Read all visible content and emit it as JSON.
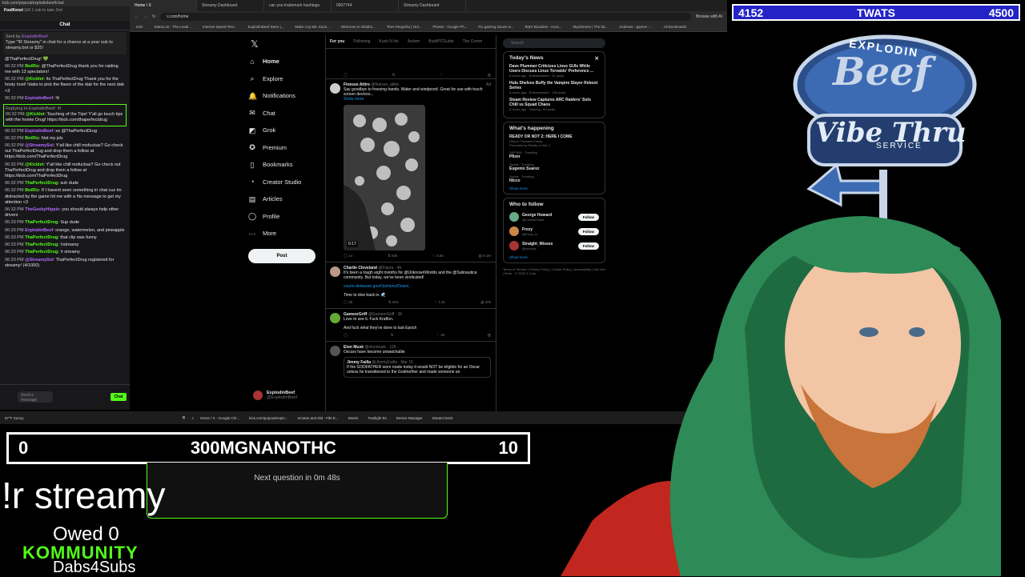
{
  "chat": {
    "url_bar": "kick.com/popout/explodinbeef/chat",
    "header": "Chat",
    "top_gifter": "FoolKenzi",
    "gift_text": "Gift 1 sub to take 2nd",
    "pin_sender": "Sent by",
    "pin_user": "ExplodinBeef",
    "pin_text": "Type \"!R Streamy\" in chat for a chance at a year sub to streamy.bot or $25!",
    "first_line": "@ThaPerfectDrug! 💚",
    "messages": [
      {
        "time": "06:32 PM",
        "user": "BotRix",
        "color": "#53fc18",
        "text": "@ThaPerfectDrug thank you for raiding me with 13 spectators!"
      },
      {
        "time": "06:32 PM",
        "user": "@Kicklet",
        "color": "#53fc18",
        "text": "Its ThaPerfectDrug Thank you for the hosty host! !dabs to pick the flavor of the dab for the next dab <3"
      },
      {
        "time": "06:32 PM",
        "user": "ExplodinBeef",
        "color": "#b36bff",
        "text": "!tt"
      },
      {
        "time": "06:32 PM",
        "user": "@Kicklet",
        "color": "#53fc18",
        "text": "Touching of the Tips! Y'all go touch tips with the homie Drug! https://kick.com/thaperfectdrug",
        "reply": "Replying to ExplodinBeef: !tt"
      },
      {
        "time": "06:32 PM",
        "user": "ExplodinBeef",
        "color": "#b36bff",
        "text": "so @ThaPerfectDrug"
      },
      {
        "time": "06:32 PM",
        "user": "BotRix",
        "color": "#53fc18",
        "text": "Not my job."
      },
      {
        "time": "06:32 PM",
        "user": "@StreamySol",
        "color": "#b36bff",
        "text": "Y'all like chill mofuckas? Go check out ThaPerfectDrug and drop them a follow at https://kick.com/ThaPerfectDrug"
      },
      {
        "time": "06:32 PM",
        "user": "@Kicklet",
        "color": "#53fc18",
        "text": "Y'all like chill mofuckas? Go check out ThaPerfectDrug and drop them a follow at https://kick.com/ThaPerfectDrug"
      },
      {
        "time": "06:32 PM",
        "user": "ThaPerfectDrug",
        "color": "#53fc18",
        "text": "suh dude"
      },
      {
        "time": "06:32 PM",
        "user": "BotRix",
        "color": "#53fc18",
        "text": "If I havent seen something in chat cuz im distracted by the game hit me with a !tts message to get my attention <3"
      },
      {
        "time": "06:32 PM",
        "user": "TheGeekyHippie",
        "color": "#b36bff",
        "text": "you should always help other drivers"
      },
      {
        "time": "06:33 PM",
        "user": "ThaPerfectDrug",
        "color": "#53fc18",
        "text": "Sup dude"
      },
      {
        "time": "06:33 PM",
        "user": "ExplodinBeef",
        "color": "#b36bff",
        "text": "orange, watermelon, and pineapple"
      },
      {
        "time": "06:33 PM",
        "user": "ThaPerfectDrug",
        "color": "#53fc18",
        "text": "that clip was funny"
      },
      {
        "time": "06:33 PM",
        "user": "ThaPerfectDrug",
        "color": "#53fc18",
        "text": "!rstreamy"
      },
      {
        "time": "06:33 PM",
        "user": "ThaPerfectDrug",
        "color": "#53fc18",
        "text": "!r streamy"
      },
      {
        "time": "06:33 PM",
        "user": "@StreamySol",
        "color": "#b36bff",
        "text": "ThaPerfectDrug registered for streamy! (4/1000)"
      }
    ],
    "input_placeholder": "Send a message",
    "send_label": "Chat"
  },
  "browser": {
    "tabs": [
      "Home / X",
      "Streamy Dashboard",
      "can you trademark hashtags",
      "0007744",
      "Streamy Dashboard"
    ],
    "url": "x.com/home",
    "ai_label": "Browse with AI",
    "bookmarks": [
      "Kick",
      "Statsu.us - The Leadi...",
      "Internet Speed Test...",
      "ExplodinBeef Store |...",
      "Make Any Mic Soun...",
      "Welcome to Oklaho...",
      "Tires Pequeño | Onl...",
      "Photos - Google Ph...",
      "Fix gaming issues w...",
      "IEEV Boosties - evos...",
      "Mynicknets | The lat...",
      "Andrews - games -...",
      "All Bookmarks"
    ]
  },
  "x": {
    "nav": [
      {
        "icon": "home-icon",
        "glyph": "⌂",
        "label": "Home"
      },
      {
        "icon": "explore-icon",
        "glyph": "⌕",
        "label": "Explore"
      },
      {
        "icon": "notifications-icon",
        "glyph": "🔔",
        "label": "Notifications"
      },
      {
        "icon": "chat-icon",
        "glyph": "✉",
        "label": "Chat"
      },
      {
        "icon": "grok-icon",
        "glyph": "◩",
        "label": "Grok"
      },
      {
        "icon": "premium-icon",
        "glyph": "✪",
        "label": "Premium"
      },
      {
        "icon": "bookmarks-icon",
        "glyph": "▯",
        "label": "Bookmarks"
      },
      {
        "icon": "creator-studio-icon",
        "glyph": "◔",
        "label": "Creator Studio"
      },
      {
        "icon": "articles-icon",
        "glyph": "▤",
        "label": "Articles"
      },
      {
        "icon": "profile-icon",
        "glyph": "◯",
        "label": "Profile"
      },
      {
        "icon": "more-icon",
        "glyph": "⋯",
        "label": "More"
      }
    ],
    "post_label": "Post",
    "profile_name": "ExplodinBeef",
    "profile_handle": "@ExplodinBeef",
    "feed_tabs": [
      "For you",
      "Following",
      "Kush N Ink",
      "Autism",
      "BuildPCGuide",
      "The Comm"
    ],
    "tweets": [
      {
        "name": "Finesse Attire",
        "handle": "@finesse_attire",
        "time": "Ad",
        "text": "Say goodbye to freezing hands. Water and windproof. Great for use with touch screen devices...",
        "more": "Show more",
        "video_time": "0:17",
        "actions": [
          "14",
          "83k",
          "5.6k",
          "9.1M"
        ]
      },
      {
        "name": "Charlie Cleveland",
        "handle": "@Flayra · 4h",
        "text": "It's been a tough eight months for @UnknownWorlds and the @Subnautica community. But today, we've been vindicated!",
        "link": "courts.delaware.gov/Opinions/Downl...",
        "text2": "Time to dive back in. 🌊",
        "actions": [
          "36",
          "563",
          "4.4k",
          "40k"
        ]
      },
      {
        "name": "GameorGriff",
        "handle": "@GameorGriff · 3h",
        "text": "Love to see it. Fuck Krafton.",
        "text2": "And fuck what they've done to last Epoch",
        "actions": [
          "",
          "",
          "46",
          ""
        ]
      },
      {
        "name": "Elon Musk",
        "handle": "@elonmusk · 12h",
        "text": "Oscars have become unwatchable",
        "quote_name": "Jimmy Failla",
        "quote_handle": "@JimmyFailla · Mar 15",
        "quote_text": "If the GODFATHER were made today it would NOT be eligible for an Oscar unless he transitioned to the Godmother and made someone an"
      }
    ],
    "search_placeholder": "Search",
    "news_title": "Today's News",
    "news": [
      {
        "title": "Dave Plummer Criticizes Linux GUIs While Users Discuss Linus Torvalds' Preference ...",
        "meta": "6 hours ago · Entertainment · 31 posts"
      },
      {
        "title": "Hulu Shelves Buffy the Vampire Slayer Reboot Series",
        "meta": "6 hours ago · Entertainment · 135 posts"
      },
      {
        "title": "Steam Review Captures ARC Raiders' Solo Chill vs Squad Chaos",
        "meta": "6 hours ago · Gaming · 84 posts"
      }
    ],
    "happening_title": "What's happening",
    "trends": [
      {
        "cat": "Only in Theaters Friday",
        "name": "READY OR NOT 2: HERE I COME",
        "extra": "Promoted by Ready or Not 2"
      },
      {
        "cat": "S&P 500 · Trending",
        "name": "Pfizer"
      },
      {
        "cat": "Sports · Trending",
        "name": "Eugenio Suarez"
      },
      {
        "cat": "Sports · Trending",
        "name": "Nicco"
      }
    ],
    "show_more": "Show more",
    "wtf_title": "Who to follow",
    "follows": [
      {
        "name": "George Howard",
        "handle": "@CosmicFlush"
      },
      {
        "name": "Frezy",
        "handle": "@Frezy_tv"
      },
      {
        "name": "Straight_Misses",
        "handle": "@zurvixty"
      }
    ],
    "follow_label": "Follow",
    "footer": "Terms of Service | Privacy Policy | Cookie Policy | Accessibility | Ads info | More · © 2025 X Corp."
  },
  "taskbar": {
    "weather": "57°F Sunny",
    "items": [
      "Home / X - Google Chr...",
      "kick.com/popout/explo...",
      "emotes and shit - File E...",
      "Steam",
      "Fastlight 84",
      "Device Manager",
      "Stream Deck"
    ]
  },
  "overlay": {
    "top_left": "4152",
    "top_mid": "TWATS",
    "top_right": "4500",
    "trivia_left": "0",
    "trivia_title": "300MGNANOTHC",
    "trivia_right": "10",
    "next_question": "Next question in 0m 48s",
    "command": "!r streamy",
    "owed": "Owed 0",
    "kommunity": "KOMMUNITY",
    "dabs": "Dabs4Subs",
    "logo_top": "EXPLODIN",
    "logo_beef": "Beef",
    "logo_vibe": "Vibe Thru",
    "logo_service": "SERVICE"
  }
}
